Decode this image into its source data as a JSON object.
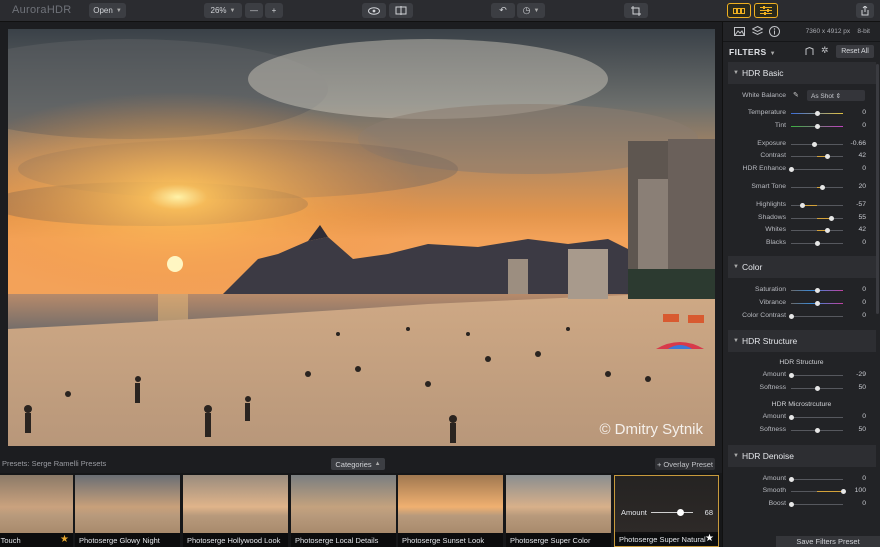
{
  "app": {
    "logo": "AuroraHDR"
  },
  "toolbar": {
    "open_label": "Open",
    "zoom_label": "26%",
    "zoom_out": "—",
    "zoom_in": "+",
    "preview_icon": "eye-icon",
    "compare_icon": "split-compare-icon",
    "undo_icon": "undo-icon",
    "history_icon": "clock-icon",
    "crop_icon": "crop-icon",
    "layers_toggle_icon": "presets-toggle-icon",
    "adjust_toggle_icon": "sliders-icon",
    "share_icon": "share-icon"
  },
  "photo": {
    "copyright": "© Dmitry Sytnik"
  },
  "presets": {
    "label": "Presets: Serge Ramelli Presets",
    "categories_label": "Categories",
    "overlay_label": "+ Overlay Preset",
    "items": [
      {
        "name": "ge Final Touch",
        "starred": true,
        "selected": false
      },
      {
        "name": "Photoserge Glowy Night",
        "starred": false,
        "selected": false
      },
      {
        "name": "Photoserge Hollywood Look",
        "starred": false,
        "selected": false
      },
      {
        "name": "Photoserge Local Details",
        "starred": false,
        "selected": false
      },
      {
        "name": "Photoserge Sunset Look",
        "starred": false,
        "selected": false
      },
      {
        "name": "Photoserge Super Color",
        "starred": false,
        "selected": false
      },
      {
        "name": "Photoserge Super Natural",
        "starred": true,
        "selected": true
      }
    ],
    "amount": {
      "label": "Amount",
      "value": "68",
      "fraction": 0.68
    }
  },
  "panel": {
    "dimensions": "7360 x 4912 px",
    "bit_depth": "8-bit",
    "filters_title": "FILTERS",
    "reset_all": "Reset All",
    "save_filters_preset": "Save Filters Preset",
    "hdr_basic": {
      "title": "HDR Basic",
      "white_balance": {
        "label": "White Balance",
        "value": "As Shot"
      },
      "rows": [
        {
          "label": "Temperature",
          "value": "0",
          "pos": 0.5,
          "grad": "temp"
        },
        {
          "label": "Tint",
          "value": "0",
          "pos": 0.5,
          "grad": "tint"
        },
        {
          "label": "Exposure",
          "value": "-0.66",
          "pos": 0.45,
          "grad": "none"
        },
        {
          "label": "Contrast",
          "value": "42",
          "pos": 0.71,
          "grad": "none"
        },
        {
          "label": "HDR Enhance",
          "value": "0",
          "pos": 0.0,
          "grad": "none"
        },
        {
          "label": "Smart Tone",
          "value": "20",
          "pos": 0.6,
          "grad": "none"
        },
        {
          "label": "Highlights",
          "value": "-57",
          "pos": 0.22,
          "grad": "none"
        },
        {
          "label": "Shadows",
          "value": "55",
          "pos": 0.78,
          "grad": "none"
        },
        {
          "label": "Whites",
          "value": "42",
          "pos": 0.71,
          "grad": "none"
        },
        {
          "label": "Blacks",
          "value": "0",
          "pos": 0.5,
          "grad": "none"
        }
      ]
    },
    "color": {
      "title": "Color",
      "rows": [
        {
          "label": "Saturation",
          "value": "0",
          "pos": 0.5,
          "grad": "sat"
        },
        {
          "label": "Vibrance",
          "value": "0",
          "pos": 0.5,
          "grad": "sat"
        },
        {
          "label": "Color Contrast",
          "value": "0",
          "pos": 0.0,
          "grad": "none"
        }
      ]
    },
    "hdr_structure": {
      "title": "HDR Structure",
      "group1_title": "HDR Structure",
      "group1": [
        {
          "label": "Amount",
          "value": "-29",
          "pos": 0.0,
          "grad": "none"
        },
        {
          "label": "Softness",
          "value": "50",
          "pos": 0.5,
          "grad": "none"
        }
      ],
      "group2_title": "HDR Microstrcuture",
      "group2": [
        {
          "label": "Amount",
          "value": "0",
          "pos": 0.0,
          "grad": "none"
        },
        {
          "label": "Softness",
          "value": "50",
          "pos": 0.5,
          "grad": "none"
        }
      ]
    },
    "hdr_denoise": {
      "title": "HDR Denoise",
      "rows": [
        {
          "label": "Amount",
          "value": "0",
          "pos": 0.0,
          "grad": "none"
        },
        {
          "label": "Smooth",
          "value": "100",
          "pos": 1.0,
          "grad": "none"
        },
        {
          "label": "Boost",
          "value": "0",
          "pos": 0.0,
          "grad": "none"
        }
      ]
    }
  },
  "colors": {
    "accent": "#d4a23a",
    "panel_bg": "#222326",
    "section_bg": "#2d2e32"
  }
}
